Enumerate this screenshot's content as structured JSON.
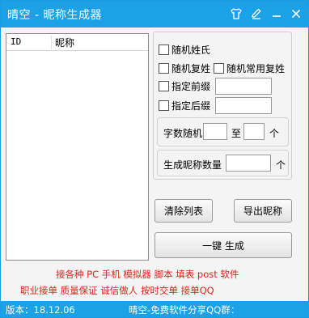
{
  "window": {
    "title": "晴空 - 昵称生成器",
    "icons": [
      "shirt-icon",
      "edit-icon",
      "minimize-icon",
      "close-icon"
    ]
  },
  "list": {
    "columns": [
      "ID",
      "昵称"
    ]
  },
  "options": {
    "random_surname": "随机姓氏",
    "random_double_surname": "随机复姓",
    "random_common_double_surname": "随机常用复姓",
    "prefix": "指定前缀",
    "prefix_value": "",
    "suffix": "指定后缀",
    "suffix_value": "",
    "word_count_label": "字数随机",
    "word_count_min": "",
    "to_label": "至",
    "word_count_max": "",
    "unit": "个",
    "count_label": "生成昵称数量",
    "count_value": "",
    "count_unit": "个"
  },
  "buttons": {
    "clear": "清除列表",
    "export": "导出昵称",
    "generate": "一键 生成"
  },
  "promo": {
    "line1": "接各种 PC 手机 模拟器 脚本 填表 post 软件",
    "line2": "职业接单 质量保证 诚信做人 按时交单 接单QQ"
  },
  "status": {
    "version": "版本：18.12.06",
    "share": "晴空-免费软件分享QQ群："
  },
  "colors": {
    "accent": "#1ba1e6",
    "promo_text": "#e0241a"
  }
}
